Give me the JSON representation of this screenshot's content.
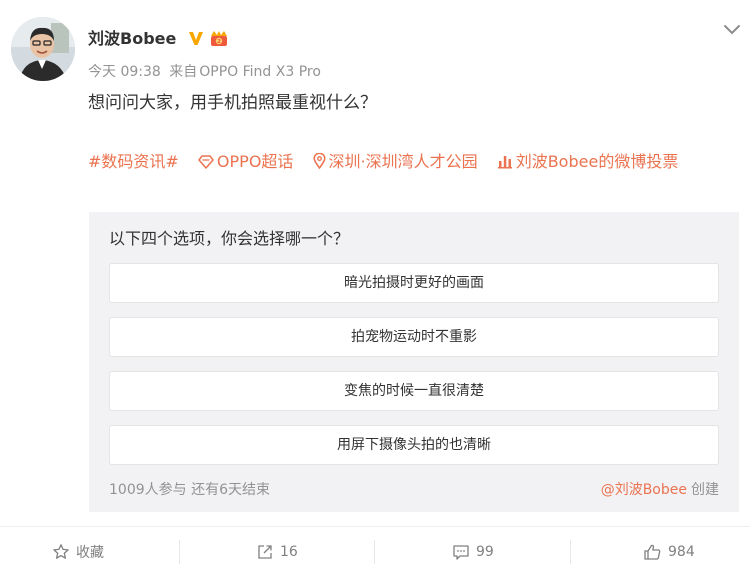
{
  "post": {
    "author": "刘波Bobee",
    "time": "今天 09:38",
    "source_prefix": "来自",
    "source": "OPPO Find X3 Pro",
    "text": "想问问大家，用手机拍照最重视什么？"
  },
  "tags": {
    "topic": "#数码资讯#",
    "supertopic": "OPPO超话",
    "location": "深圳·深圳湾人才公园",
    "poll_link": "刘波Bobee的微博投票"
  },
  "poll": {
    "question": "以下四个选项，你会选择哪一个？",
    "options": [
      "暗光拍摄时更好的画面",
      "拍宠物运动时不重影",
      "变焦的时候一直很清楚",
      "用屏下摄像头拍的也清晰"
    ],
    "participants": "1009人参与",
    "remaining": "还有6天结束",
    "creator": "@刘波Bobee",
    "created_label": "创建"
  },
  "actions": {
    "favorite_label": "收藏",
    "repost_count": "16",
    "comment_count": "99",
    "like_count": "984"
  },
  "colors": {
    "accent": "#eb7350",
    "verified": "#f7a700",
    "text": "#333333",
    "muted": "#939393",
    "poll_bg": "#f2f2f5"
  },
  "icons": {
    "avatar": "avatar",
    "verified": "verified-v-icon",
    "member": "member-badge-icon",
    "menu": "chevron-down-icon",
    "supertopic": "diamond-icon",
    "location": "location-pin-icon",
    "poll": "poll-bars-icon",
    "favorite": "star-icon",
    "repost": "repost-icon",
    "comment": "comment-icon",
    "like": "thumbs-up-icon"
  }
}
